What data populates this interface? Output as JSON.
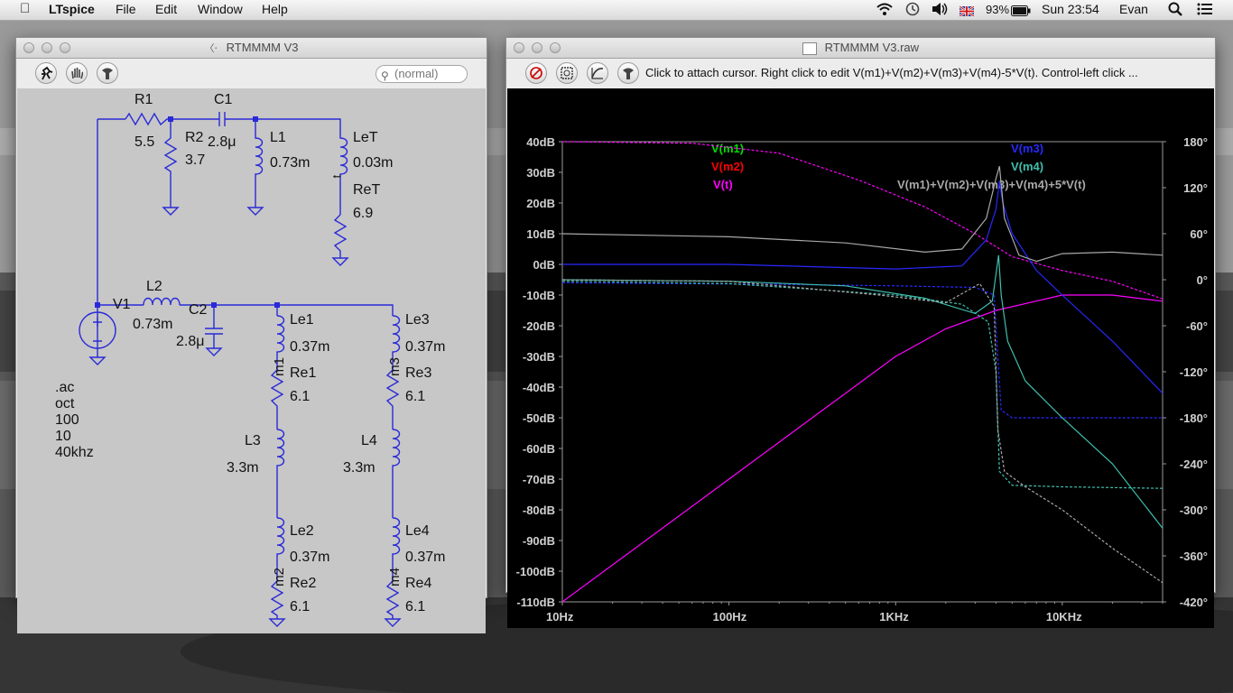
{
  "menubar": {
    "app_name": "LTspice",
    "menus": [
      "File",
      "Edit",
      "Window",
      "Help"
    ],
    "battery": "93%",
    "clock": "Sun 23:54",
    "user": "Evan"
  },
  "schematic_window": {
    "title": "RTMMMM V3",
    "search_placeholder": "(normal)",
    "components": {
      "R1": {
        "name": "R1",
        "value": "5.5"
      },
      "R2": {
        "name": "R2",
        "value": "3.7"
      },
      "C1": {
        "name": "C1",
        "value": "2.8μ"
      },
      "L1": {
        "name": "L1",
        "value": "0.73m"
      },
      "LeT": {
        "name": "LeT",
        "value": "0.03m"
      },
      "ReT": {
        "name": "ReT",
        "value": "6.9"
      },
      "V1": {
        "name": "V1"
      },
      "L2": {
        "name": "L2",
        "value": "0.73m"
      },
      "C2": {
        "name": "C2",
        "value": "2.8μ"
      },
      "Le1": {
        "name": "Le1",
        "value": "0.37m"
      },
      "Re1": {
        "name": "Re1",
        "value": "6.1"
      },
      "L3": {
        "name": "L3",
        "value": "3.3m"
      },
      "Le2": {
        "name": "Le2",
        "value": "0.37m"
      },
      "Re2": {
        "name": "Re2",
        "value": "6.1"
      },
      "Le3": {
        "name": "Le3",
        "value": "0.37m"
      },
      "Re3": {
        "name": "Re3",
        "value": "6.1"
      },
      "L4": {
        "name": "L4",
        "value": "3.3m"
      },
      "Le4": {
        "name": "Le4",
        "value": "0.37m"
      },
      "Re4": {
        "name": "Re4",
        "value": "6.1"
      }
    },
    "net_labels": {
      "m1": "m1",
      "m2": "m2",
      "m3": "m3",
      "m4": "m4",
      "t": "t"
    },
    "directive": ".ac oct 100 10 40khz"
  },
  "waveform_window": {
    "title": "RTMMMM V3.raw",
    "hint": "Click to attach cursor.  Right click to edit V(m1)+V(m2)+V(m3)+V(m4)-5*V(t).  Control-left click ..."
  },
  "chart_data": {
    "type": "line",
    "x_scale": "log",
    "xlim": [
      10,
      40000
    ],
    "ylim": [
      -110,
      40
    ],
    "y2lim": [
      -420,
      180
    ],
    "x_ticks": [
      "10Hz",
      "100Hz",
      "1KHz",
      "10KHz"
    ],
    "y_ticks": [
      "40dB",
      "30dB",
      "20dB",
      "10dB",
      "0dB",
      "-10dB",
      "-20dB",
      "-30dB",
      "-40dB",
      "-50dB",
      "-60dB",
      "-70dB",
      "-80dB",
      "-90dB",
      "-100dB",
      "-110dB"
    ],
    "y2_ticks": [
      "180°",
      "120°",
      "60°",
      "0°",
      "-60°",
      "-120°",
      "-180°",
      "-240°",
      "-300°",
      "-360°",
      "-420°"
    ],
    "legend": [
      {
        "label": "V(m1)",
        "color": "#00e000"
      },
      {
        "label": "V(m2)",
        "color": "#ff0000"
      },
      {
        "label": "V(t)",
        "color": "#ff00ff"
      },
      {
        "label": "V(m3)",
        "color": "#2828ff"
      },
      {
        "label": "V(m4)",
        "color": "#3fbfae"
      },
      {
        "label": "V(m1)+V(m2)+V(m3)+V(m4)+5*V(t)",
        "color": "#a8a8a8"
      }
    ],
    "series": [
      {
        "name": "V(t)",
        "color": "#ff00ff",
        "dashed": false,
        "points": [
          [
            10,
            -110
          ],
          [
            100,
            -70
          ],
          [
            1000,
            -30
          ],
          [
            2000,
            -21
          ],
          [
            4000,
            -15
          ],
          [
            10000,
            -10
          ],
          [
            20000,
            -10
          ],
          [
            40000,
            -12
          ]
        ]
      },
      {
        "name": "V(t) phase",
        "color": "#ff00ff",
        "dashed": true,
        "axis": "y2",
        "points": [
          [
            10,
            180
          ],
          [
            60,
            178
          ],
          [
            200,
            165
          ],
          [
            600,
            130
          ],
          [
            1500,
            95
          ],
          [
            3000,
            60
          ],
          [
            5000,
            30
          ],
          [
            10000,
            12
          ],
          [
            20000,
            -2
          ],
          [
            40000,
            -25
          ]
        ]
      },
      {
        "name": "V(m3)",
        "color": "#2828ff",
        "dashed": false,
        "points": [
          [
            10,
            0
          ],
          [
            100,
            0
          ],
          [
            1000,
            -1.5
          ],
          [
            2500,
            -0.5
          ],
          [
            3500,
            8
          ],
          [
            4000,
            18
          ],
          [
            4200,
            27
          ],
          [
            4400,
            20
          ],
          [
            5000,
            10
          ],
          [
            7000,
            -2
          ],
          [
            10000,
            -10
          ],
          [
            20000,
            -25
          ],
          [
            40000,
            -42
          ]
        ]
      },
      {
        "name": "V(m3) phase",
        "color": "#2828ff",
        "dashed": true,
        "axis": "y2",
        "points": [
          [
            10,
            -4
          ],
          [
            200,
            -6
          ],
          [
            1000,
            -8
          ],
          [
            3000,
            -10
          ],
          [
            3900,
            -20
          ],
          [
            4100,
            -100
          ],
          [
            4300,
            -170
          ],
          [
            5000,
            -180
          ],
          [
            40000,
            -180
          ]
        ]
      },
      {
        "name": "V(m4)",
        "color": "#3fbfae",
        "dashed": false,
        "points": [
          [
            10,
            -5
          ],
          [
            100,
            -5.5
          ],
          [
            500,
            -7
          ],
          [
            1500,
            -11
          ],
          [
            3000,
            -16
          ],
          [
            3800,
            -12
          ],
          [
            4150,
            3
          ],
          [
            4300,
            -10
          ],
          [
            4700,
            -25
          ],
          [
            6000,
            -38
          ],
          [
            10000,
            -50
          ],
          [
            20000,
            -65
          ],
          [
            40000,
            -86
          ]
        ]
      },
      {
        "name": "V(m4) phase",
        "color": "#3fbfae",
        "dashed": true,
        "axis": "y2",
        "points": [
          [
            10,
            -2
          ],
          [
            100,
            -5
          ],
          [
            300,
            -12
          ],
          [
            1000,
            -20
          ],
          [
            2500,
            -32
          ],
          [
            3600,
            -55
          ],
          [
            4000,
            -120
          ],
          [
            4200,
            -250
          ],
          [
            5000,
            -268
          ],
          [
            10000,
            -270
          ],
          [
            40000,
            -272
          ]
        ]
      },
      {
        "name": "Sum",
        "color": "#a8a8a8",
        "dashed": false,
        "points": [
          [
            10,
            10
          ],
          [
            100,
            9
          ],
          [
            500,
            7
          ],
          [
            1500,
            4
          ],
          [
            2500,
            5
          ],
          [
            3500,
            15
          ],
          [
            4000,
            28
          ],
          [
            4200,
            32
          ],
          [
            4500,
            15
          ],
          [
            5500,
            3
          ],
          [
            7000,
            1
          ],
          [
            10000,
            3.5
          ],
          [
            20000,
            4
          ],
          [
            40000,
            3
          ]
        ]
      },
      {
        "name": "Sum phase",
        "color": "#a8a8a8",
        "dashed": true,
        "axis": "y2",
        "points": [
          [
            10,
            0
          ],
          [
            100,
            -2
          ],
          [
            800,
            -20
          ],
          [
            2000,
            -30
          ],
          [
            3200,
            -5
          ],
          [
            3900,
            -35
          ],
          [
            4100,
            -195
          ],
          [
            4500,
            -250
          ],
          [
            6000,
            -270
          ],
          [
            10000,
            -300
          ],
          [
            20000,
            -350
          ],
          [
            40000,
            -395
          ]
        ]
      }
    ]
  }
}
